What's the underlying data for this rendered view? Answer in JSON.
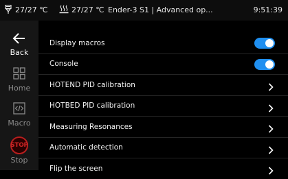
{
  "status": {
    "hotend_temp": "27/27 ℃",
    "bed_temp": "27/27 ℃",
    "title": "Ender-3 S1 | Advanced op...",
    "time": "9:51:39"
  },
  "sidebar": {
    "items": [
      {
        "label": "Back",
        "icon": "arrow-left-icon",
        "active": true
      },
      {
        "label": "Home",
        "icon": "grid-icon"
      },
      {
        "label": "Macro",
        "icon": "code-icon"
      },
      {
        "label": "Stop",
        "icon": "stop-icon",
        "badge": "STOP"
      }
    ]
  },
  "settings": [
    {
      "label": "Display macros",
      "control": "toggle",
      "on": true
    },
    {
      "label": "Console",
      "control": "toggle",
      "on": true
    },
    {
      "label": "HOTEND PID calibration",
      "control": "chevron"
    },
    {
      "label": "HOTBED PID calibration",
      "control": "chevron"
    },
    {
      "label": "Measuring Resonances",
      "control": "chevron"
    },
    {
      "label": "Automatic detection",
      "control": "chevron"
    },
    {
      "label": "Flip the screen",
      "control": "chevron"
    }
  ],
  "colors": {
    "accent": "#1f8ff0",
    "stop": "#b81e1e",
    "sidebar_bg": "#161616",
    "background": "#000000"
  }
}
